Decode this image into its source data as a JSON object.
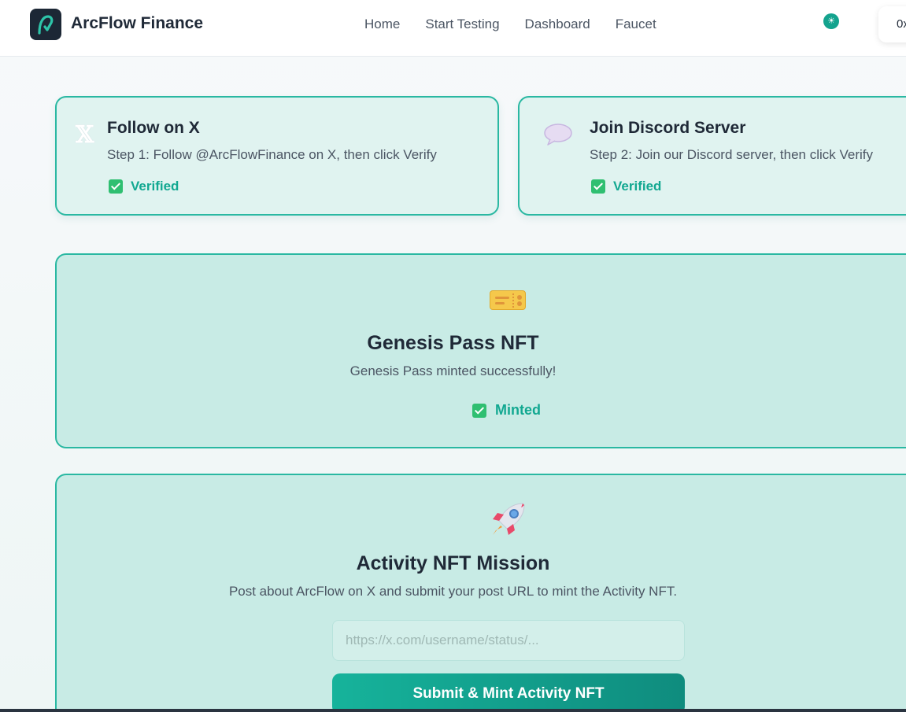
{
  "header": {
    "brand": "ArcFlow Finance",
    "nav": [
      "Home",
      "Start Testing",
      "Dashboard",
      "Faucet"
    ],
    "theme_toggle_icon": "sun-icon",
    "wallet_label": "0x"
  },
  "steps": [
    {
      "icon": "x-logo-icon",
      "glyph": "𝕏",
      "title": "Follow on X",
      "description": "Step 1: Follow @ArcFlowFinance on X, then click Verify",
      "status": "Verified"
    },
    {
      "icon": "speech-bubble-icon",
      "title": "Join Discord Server",
      "description": "Step 2: Join our Discord server, then click Verify",
      "status": "Verified"
    }
  ],
  "genesis": {
    "icon": "ticket-icon",
    "title": "Genesis Pass NFT",
    "subtitle": "Genesis Pass minted successfully!",
    "status": "Minted"
  },
  "activity": {
    "icon": "rocket-icon",
    "title": "Activity NFT Mission",
    "subtitle": "Post about ArcFlow on X and submit your post URL to mint the Activity NFT.",
    "input_placeholder": "https://x.com/username/status/...",
    "input_value": "",
    "submit_label": "Submit & Mint Activity NFT"
  },
  "colors": {
    "accent": "#14a38e",
    "card_border": "#2ab8a2",
    "status_text": "#12a891",
    "check_green": "#2fbf71"
  }
}
